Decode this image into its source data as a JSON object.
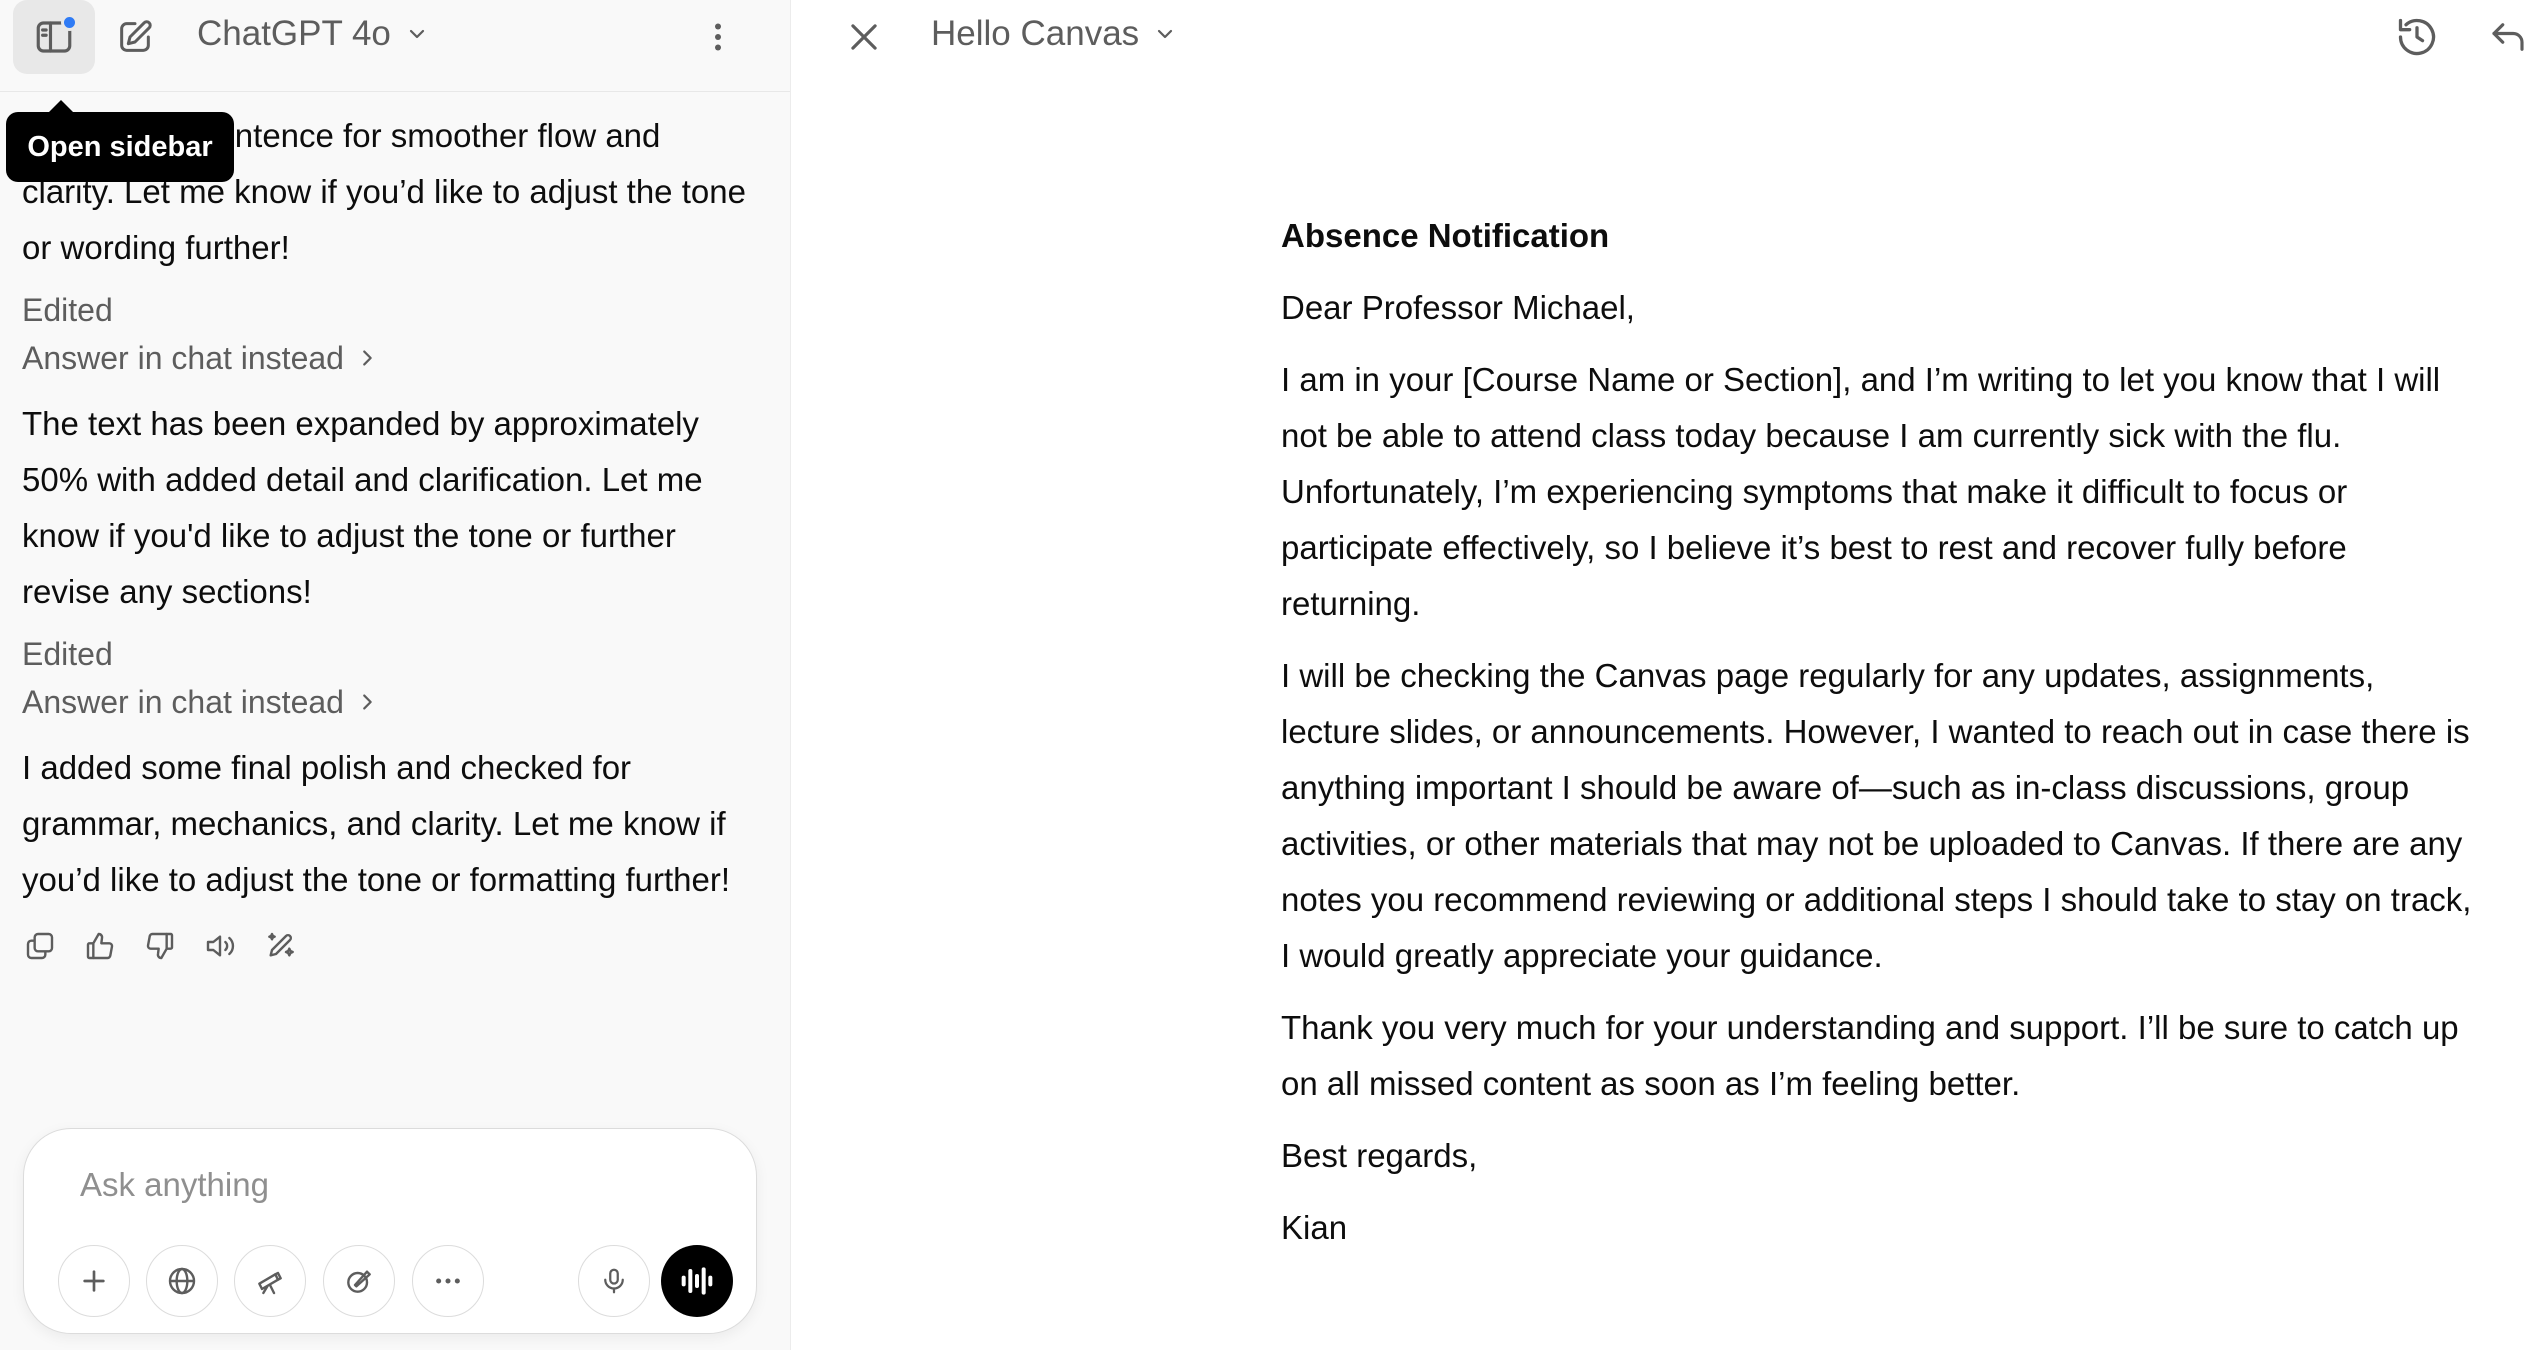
{
  "header": {
    "model_name": "ChatGPT 4o",
    "tooltip": "Open sidebar"
  },
  "chat": {
    "partial_message": "Refined the sentence for smoother flow and clarity. Let me know if you’d like to adjust the tone or wording further!",
    "edited_1": "Edited",
    "answer_in_chat_1": "Answer in chat instead",
    "message_2": "The text has been expanded by approximately 50% with added detail and clarification. Let me know if you'd like to adjust the tone or further revise any sections!",
    "edited_2": "Edited",
    "answer_in_chat_2": "Answer in chat instead",
    "message_3": "I added some final polish and checked for grammar, mechanics, and clarity. Let me know if you’d like to adjust the tone or formatting further!"
  },
  "composer": {
    "placeholder": "Ask anything"
  },
  "canvas": {
    "title": "Hello Canvas",
    "doc_title": "Absence Notification",
    "greeting": "Dear Professor Michael,",
    "paragraph_1": "I am in your [Course Name or Section], and I’m writing to let you know that I will not be able to attend class today because I am currently sick with the flu. Unfortunately, I’m experiencing symptoms that make it difficult to focus or participate effectively, so I believe it’s best to rest and recover fully before returning.",
    "paragraph_2": "I will be checking the Canvas page regularly for any updates, assignments, lecture slides, or announcements. However, I wanted to reach out in case there is anything important I should be aware of—such as in-class discussions, group activities, or other materials that may not be uploaded to Canvas. If there are any notes you recommend reviewing or additional steps I should take to stay on track, I would greatly appreciate your guidance.",
    "paragraph_3": "Thank you very much for your understanding and support. I’ll be sure to catch up on all missed content as soon as I’m feeling better.",
    "closing": "Best regards,",
    "signature": "Kian"
  },
  "colors": {
    "notification_dot": "#2f7bf5",
    "voice_button": "#000000",
    "tooltip_bg": "#000000"
  },
  "icons": [
    "sidebar-icon",
    "edit-icon",
    "chevron-down-icon",
    "more-vertical-icon",
    "close-icon",
    "history-icon",
    "undo-icon",
    "copy-icon",
    "thumbs-up-icon",
    "thumbs-down-icon",
    "read-aloud-icon",
    "edit-in-canvas-icon",
    "plus-icon",
    "globe-icon",
    "telescope-icon",
    "canvas-tool-icon",
    "more-horizontal-icon",
    "microphone-icon",
    "voice-mode-icon"
  ]
}
